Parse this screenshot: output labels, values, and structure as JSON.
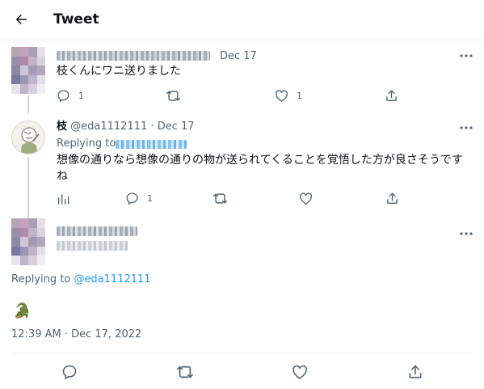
{
  "header": {
    "title": "Tweet"
  },
  "tweets": [
    {
      "date": "Dec 17",
      "text": "枝くんにワニ送りました",
      "reply_count": "1",
      "like_count": "1"
    },
    {
      "display_name": "枝",
      "handle": "@eda1112111",
      "separator": "·",
      "date": "Dec 17",
      "replying_label": "Replying to",
      "text": "想像の通りなら想像の通りの物が送られてくることを覚悟した方が良さそうですね",
      "reply_count": "1"
    }
  ],
  "main_tweet": {
    "replying_label": "Replying to",
    "replying_handle": "@eda1112111",
    "emoji": "🐊",
    "timestamp": "12:39 AM · Dec 17, 2022"
  },
  "colors": {
    "accent": "#1d9bf0",
    "muted": "#536471",
    "text": "#0f1419",
    "border": "#eff3f4"
  }
}
